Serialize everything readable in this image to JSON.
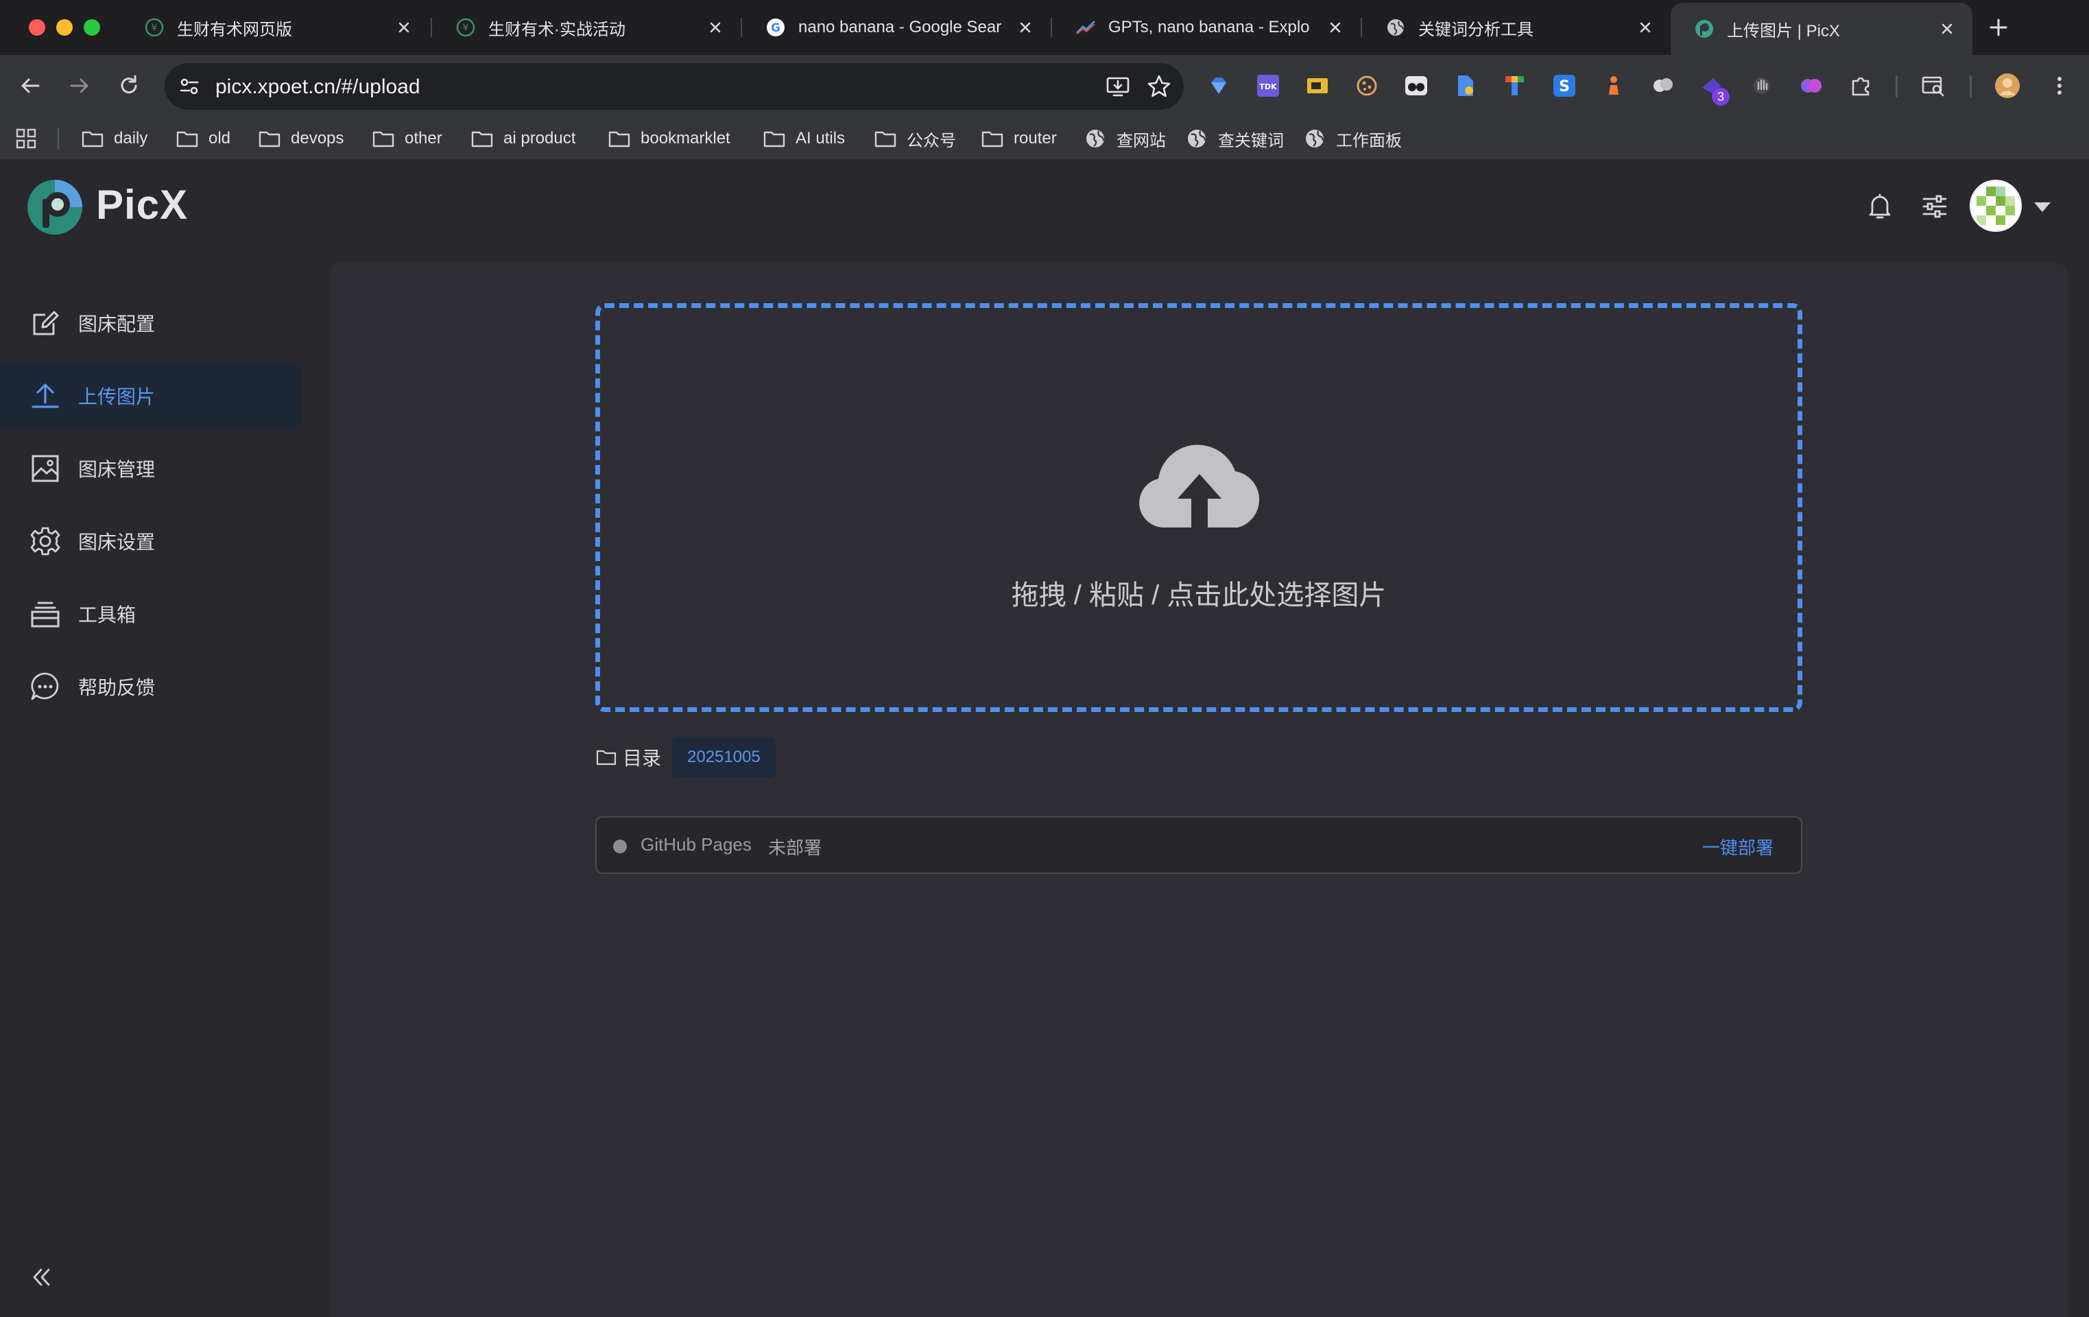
{
  "browser": {
    "tabs": [
      {
        "title": "生财有术网页版",
        "icon": "shengcai-favicon"
      },
      {
        "title": "生财有术·实战活动",
        "icon": "shengcai-favicon"
      },
      {
        "title": "nano banana - Google Sear",
        "icon": "google-favicon"
      },
      {
        "title": "GPTs, nano banana - Explo",
        "icon": "trend-favicon"
      },
      {
        "title": "关键词分析工具",
        "icon": "globe-favicon"
      },
      {
        "title": "上传图片 | PicX",
        "icon": "picx-favicon",
        "active": true
      }
    ],
    "url": "picx.xpoet.cn/#/upload",
    "extension_badge": "3",
    "bookmarks": [
      {
        "label": "daily",
        "type": "folder"
      },
      {
        "label": "old",
        "type": "folder"
      },
      {
        "label": "devops",
        "type": "folder"
      },
      {
        "label": "other",
        "type": "folder"
      },
      {
        "label": "ai product",
        "type": "folder"
      },
      {
        "label": "bookmarklet",
        "type": "folder"
      },
      {
        "label": "AI utils",
        "type": "folder"
      },
      {
        "label": "公众号",
        "type": "folder"
      },
      {
        "label": "router",
        "type": "folder"
      },
      {
        "label": "查网站",
        "type": "site"
      },
      {
        "label": "查关键词",
        "type": "site"
      },
      {
        "label": "工作面板",
        "type": "site"
      }
    ]
  },
  "app": {
    "name": "PicX",
    "sidebar": [
      {
        "label": "图床配置",
        "icon": "edit-icon"
      },
      {
        "label": "上传图片",
        "icon": "upload-icon",
        "active": true
      },
      {
        "label": "图床管理",
        "icon": "image-icon"
      },
      {
        "label": "图床设置",
        "icon": "gear-icon"
      },
      {
        "label": "工具箱",
        "icon": "toolbox-icon"
      },
      {
        "label": "帮助反馈",
        "icon": "chat-icon"
      }
    ],
    "upload": {
      "hint": "拖拽 / 粘贴 / 点击此处选择图片",
      "dir_label": "目录",
      "dir_value": "20251005"
    },
    "deploy": {
      "name": "GitHub Pages",
      "status": "未部署",
      "action": "一键部署"
    }
  },
  "colors": {
    "accent": "#4f8ff0",
    "background": "#28282d",
    "panel": "#2e2e34"
  }
}
